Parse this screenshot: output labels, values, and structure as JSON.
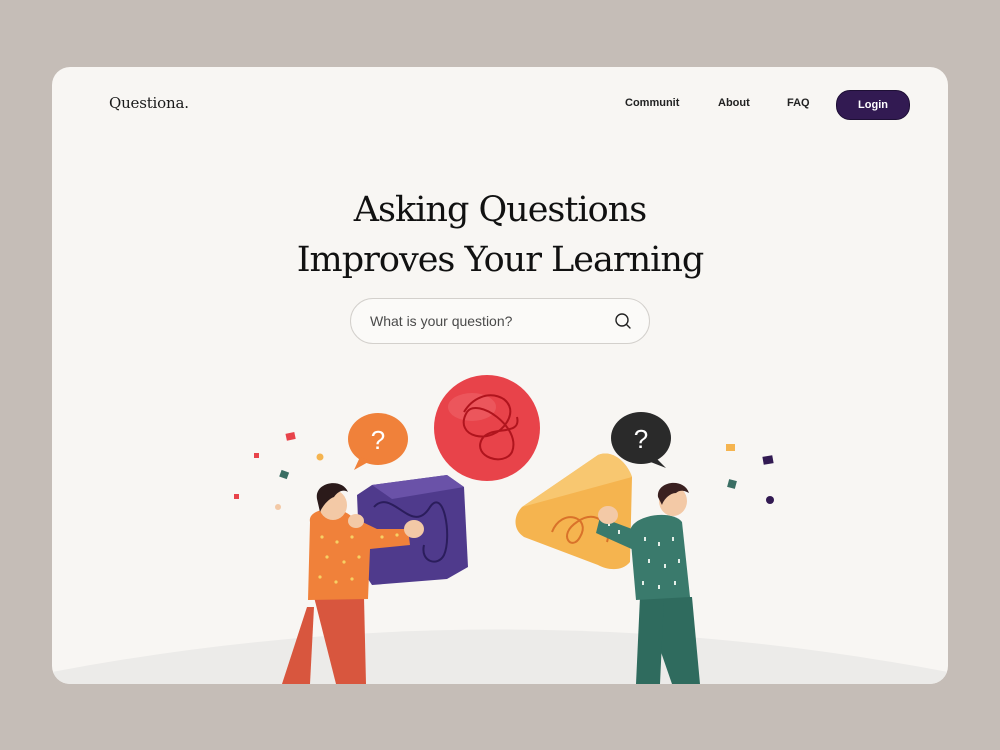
{
  "brand": {
    "name": "Questiona."
  },
  "nav": {
    "links": [
      {
        "label": "Communit"
      },
      {
        "label": "About"
      },
      {
        "label": "FAQ"
      }
    ],
    "login_label": "Login"
  },
  "hero": {
    "title_line1": "Asking Questions",
    "title_line2": "Improves Your Learning"
  },
  "search": {
    "placeholder": "What is your question?"
  },
  "illustration": {
    "left_bubble": "?",
    "right_bubble": "?"
  },
  "colors": {
    "background": "#c5bdb7",
    "card": "#f8f6f3",
    "accent": "#321a52",
    "orange_bubble": "#f0813a",
    "dark_bubble": "#2a2a2a",
    "red_sphere": "#e8434a",
    "purple_cube": "#4f3a8c",
    "yellow_shape": "#f5b44f"
  }
}
